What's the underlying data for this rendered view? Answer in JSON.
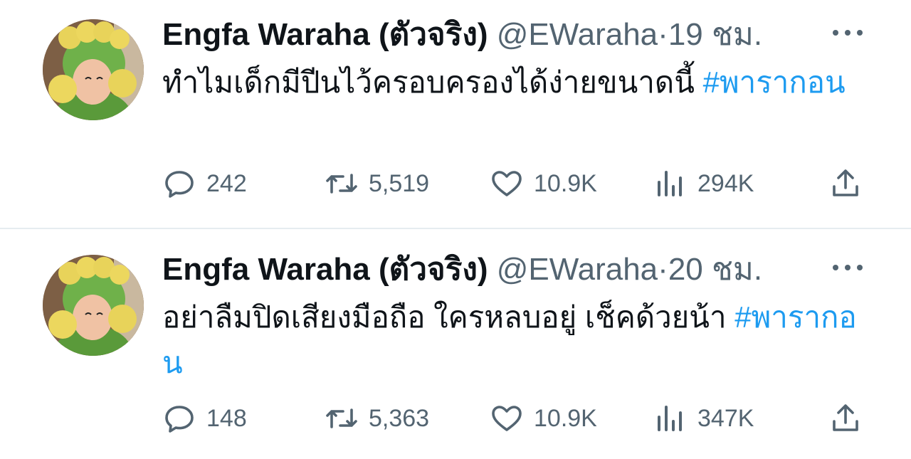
{
  "tweets": [
    {
      "display_name": "Engfa Waraha (ตัวจริง)",
      "handle": "@EWaraha",
      "separator": "·",
      "time": "19 ชม.",
      "text": "ทำไมเด็กมีปีนไว้ครอบครองได้ง่ายขนาดนี้ ",
      "hashtag": "#พารากอน",
      "replies": "242",
      "retweets": "5,519",
      "likes": "10.9K",
      "views": "294K"
    },
    {
      "display_name": "Engfa Waraha (ตัวจริง)",
      "handle": "@EWaraha",
      "separator": "·",
      "time": "20 ชม.",
      "text": "อย่าลืมปิดเสียงมือถือ ใครหลบอยู่ เช็คด้วยน้า ",
      "hashtag": "#พารากอน",
      "replies": "148",
      "retweets": "5,363",
      "likes": "10.9K",
      "views": "347K"
    }
  ],
  "icons": {
    "reply": "reply-icon",
    "retweet": "retweet-icon",
    "like": "heart-icon",
    "views": "views-icon",
    "share": "share-icon",
    "more": "more-icon"
  },
  "colors": {
    "hashtag": "#1d9bf0",
    "secondary_text": "#536471",
    "primary_text": "#0f1419",
    "divider": "#e6ecf0"
  }
}
